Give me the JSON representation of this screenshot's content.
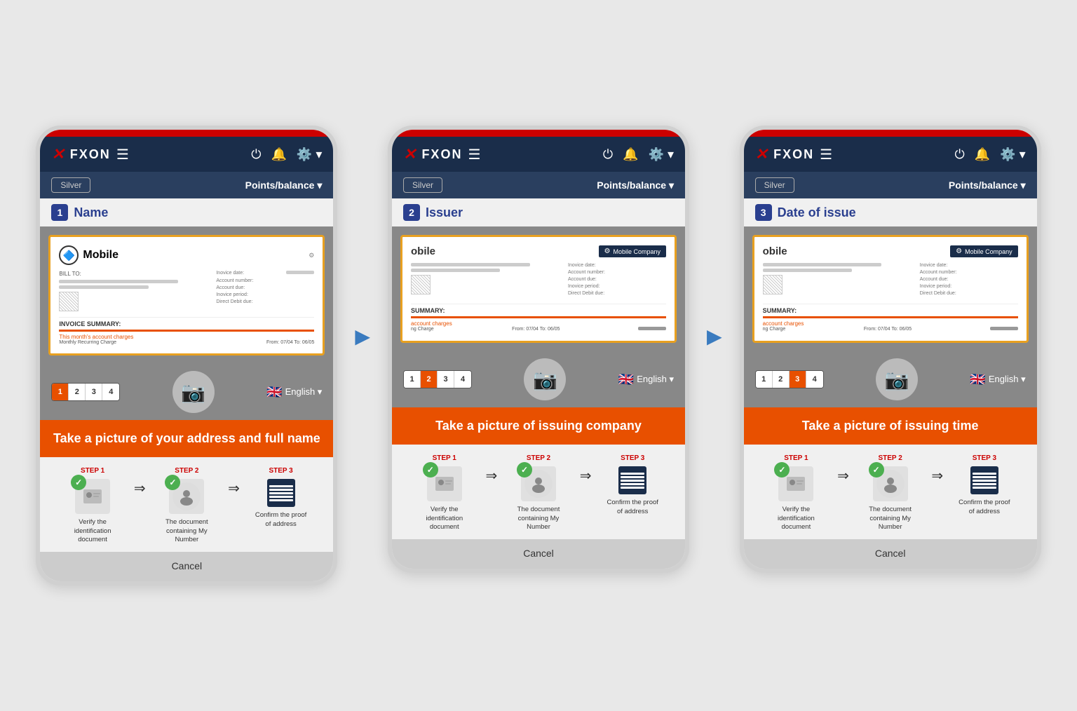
{
  "phones": [
    {
      "id": "phone1",
      "step_number": "1",
      "step_title": "Name",
      "doc_title": "Mobile",
      "show_company_badge": false,
      "cta_text": "Take a picture of your address and full name",
      "active_step_dot": 1,
      "lang": "English",
      "steps": [
        {
          "label": "STEP 1",
          "desc": "Verify the identification document"
        },
        {
          "label": "STEP 2",
          "desc": "The document containing My Number"
        },
        {
          "label": "STEP 3",
          "desc": "Confirm the proof of address"
        }
      ],
      "cancel_label": "Cancel"
    },
    {
      "id": "phone2",
      "step_number": "2",
      "step_title": "Issuer",
      "doc_title": "obile",
      "show_company_badge": true,
      "cta_text": "Take a picture of issuing company",
      "active_step_dot": 2,
      "lang": "English",
      "steps": [
        {
          "label": "STEP 1",
          "desc": "Verify the identification document"
        },
        {
          "label": "STEP 2",
          "desc": "The document containing My Number"
        },
        {
          "label": "STEP 3",
          "desc": "Confirm the proof of address"
        }
      ],
      "cancel_label": "Cancel"
    },
    {
      "id": "phone3",
      "step_number": "3",
      "step_title": "Date of issue",
      "doc_title": "obile",
      "show_company_badge": true,
      "cta_text": "Take a picture of issuing time",
      "active_step_dot": 3,
      "lang": "English",
      "steps": [
        {
          "label": "STEP 1",
          "desc": "Verify the identification document"
        },
        {
          "label": "STEP 2",
          "desc": "The document containing My Number"
        },
        {
          "label": "STEP 3",
          "desc": "Confirm the proof of address"
        }
      ],
      "cancel_label": "Cancel"
    }
  ],
  "logo": "FXON",
  "silver_label": "Silver",
  "points_balance_label": "Points/balance",
  "mobile_company_label": "Mobile Company",
  "bill_to_label": "BILL TO:",
  "invoice_date_label": "Inovice date:",
  "account_number_label": "Account number:",
  "account_due_label": "Account due:",
  "invoice_period_label": "Inovice period:",
  "direct_debit_label": "Direct Debit due:",
  "invoice_summary_label": "INVOICE SUMMARY:",
  "monthly_charges_label": "This month's account charges",
  "monthly_recurring_label": "Monthly Recurring Charge",
  "from_to_label": "From: 07/04  To: 06/05"
}
